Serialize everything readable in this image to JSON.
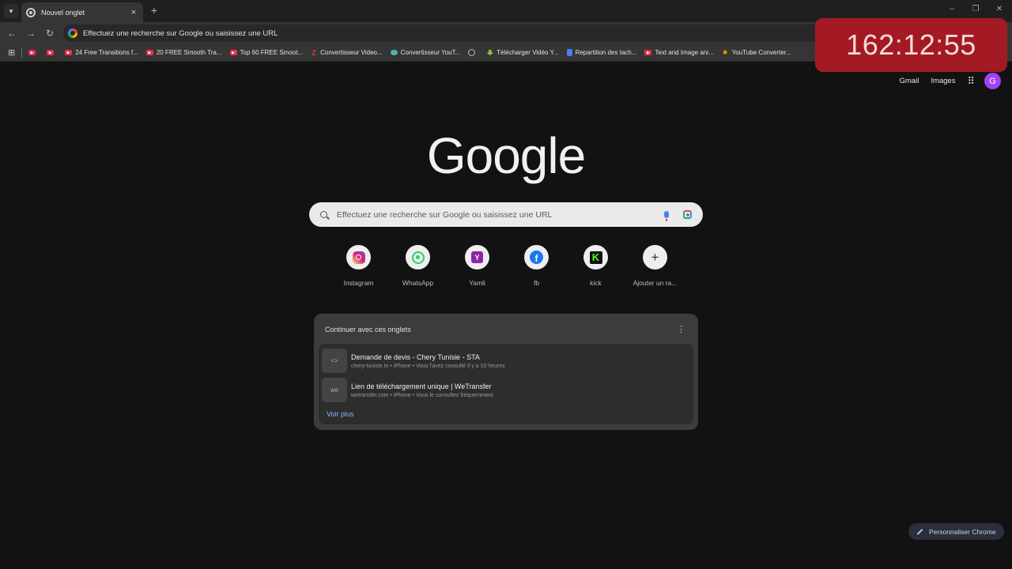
{
  "browser": {
    "tab": {
      "title": "Nouvel onglet",
      "close": "×"
    },
    "new_tab": "+",
    "window_controls": [
      "–",
      "❐",
      "✕"
    ],
    "nav": {
      "back": "←",
      "forward": "→",
      "reload": "↻"
    },
    "omnibox_text": "Effectuez une recherche sur Google ou saisissez une URL"
  },
  "bookmarks": [
    {
      "label": "",
      "icon": "youtube-icon"
    },
    {
      "label": "",
      "icon": "youtube-icon"
    },
    {
      "label": "24 Free Transitions f...",
      "icon": "youtube-icon"
    },
    {
      "label": "20 FREE Smooth Tra...",
      "icon": "youtube-icon"
    },
    {
      "label": "Top 60 FREE Smoot...",
      "icon": "youtube-icon"
    },
    {
      "label": "Convertisseur Video...",
      "icon": "z-icon"
    },
    {
      "label": "Convertisseur YouT...",
      "icon": "converter-icon"
    },
    {
      "label": "",
      "icon": "globe-icon"
    },
    {
      "label": "Télécharger Vidéo Y...",
      "icon": "download-icon"
    },
    {
      "label": "Repartition des tach...",
      "icon": "doc-icon"
    },
    {
      "label": "Text and Image ani...",
      "icon": "youtube-icon"
    },
    {
      "label": "YouTube Converter...",
      "icon": "orange-icon"
    }
  ],
  "timer": "162:12:55",
  "header": {
    "gmail": "Gmail",
    "images": "Images",
    "avatar_initial": "G"
  },
  "logo": "Google",
  "search": {
    "placeholder": "Effectuez une recherche sur Google ou saisissez une URL"
  },
  "shortcuts": [
    {
      "label": "Instagram",
      "icon": "instagram-icon"
    },
    {
      "label": "WhatsApp",
      "icon": "whatsapp-icon"
    },
    {
      "label": "Yamli",
      "icon": "yamli-icon",
      "glyph": "Y"
    },
    {
      "label": "fb",
      "icon": "facebook-icon",
      "glyph": "f"
    },
    {
      "label": "kick",
      "icon": "kick-icon",
      "glyph": "K"
    },
    {
      "label": "Ajouter un ra...",
      "icon": "plus-icon",
      "glyph": "+"
    }
  ],
  "continue_card": {
    "title": "Continuer avec ces onglets",
    "items": [
      {
        "title": "Demande de devis - Chery Tunisie - STA",
        "subtitle": "chery-tunisie.tn • iPhone • Vous l'avez consulté il y a 10 heures",
        "thumb": "<>"
      },
      {
        "title": "Lien de téléchargement unique | WeTransfer",
        "subtitle": "wetransfer.com • iPhone • Vous le consultez fréquemment",
        "thumb": "we"
      }
    ],
    "more_link": "Voir plus"
  },
  "customize_label": "Personnaliser Chrome"
}
